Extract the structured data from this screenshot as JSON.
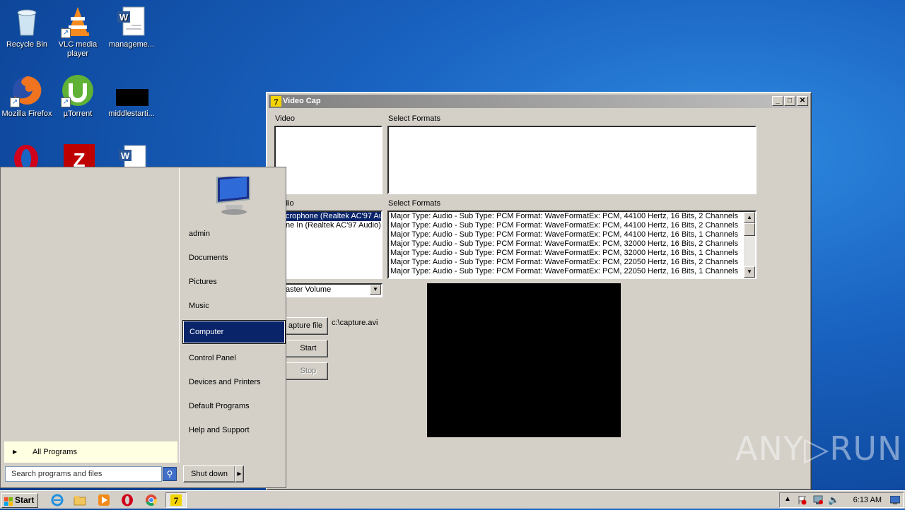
{
  "desktop": {
    "icons": [
      {
        "label": "Recycle Bin",
        "icon": "recycle-bin-icon"
      },
      {
        "label": "VLC media player",
        "icon": "vlc-icon"
      },
      {
        "label": "manageme...",
        "icon": "word-document-icon"
      },
      {
        "label": "Mozilla Firefox",
        "icon": "firefox-icon"
      },
      {
        "label": "µTorrent",
        "icon": "utorrent-icon"
      },
      {
        "label": "middlestarti...",
        "icon": "black-thumbnail-icon"
      }
    ]
  },
  "window": {
    "title": "Video Cap",
    "minimize": "_",
    "maximize": "□",
    "close": "✕",
    "video_label": "Video",
    "video_formats_label": "Select Formats",
    "audio_label": "dio",
    "audio_formats_label": "Select Formats",
    "audio_devices": [
      {
        "label": "crophone (Realtek AC'97 Au",
        "selected": true
      },
      {
        "label": "ne In (Realtek AC'97 Audio)",
        "selected": false
      }
    ],
    "audio_formats": [
      "Major Type: Audio - Sub Type: PCM Format: WaveFormatEx: PCM, 44100 Hertz, 16 Bits, 2 Channels",
      "Major Type: Audio - Sub Type: PCM Format: WaveFormatEx: PCM, 44100 Hertz, 16 Bits, 2 Channels",
      "Major Type: Audio - Sub Type: PCM Format: WaveFormatEx: PCM, 44100 Hertz, 16 Bits, 1 Channels",
      "Major Type: Audio - Sub Type: PCM Format: WaveFormatEx: PCM, 32000 Hertz, 16 Bits, 2 Channels",
      "Major Type: Audio - Sub Type: PCM Format: WaveFormatEx: PCM, 32000 Hertz, 16 Bits, 1 Channels",
      "Major Type: Audio - Sub Type: PCM Format: WaveFormatEx: PCM, 22050 Hertz, 16 Bits, 2 Channels",
      "Major Type: Audio - Sub Type: PCM Format: WaveFormatEx: PCM, 22050 Hertz, 16 Bits, 1 Channels"
    ],
    "volume_select": "aster Volume",
    "capture_file_button": "apture file",
    "capture_path": "c:\\capture.avi",
    "start_button": "Start",
    "stop_button": "Stop"
  },
  "start_menu": {
    "user": "admin",
    "right_items": [
      {
        "label": "Documents",
        "active": false
      },
      {
        "label": "Pictures",
        "active": false
      },
      {
        "label": "Music",
        "active": false
      },
      {
        "label": "Computer",
        "active": true
      },
      {
        "label": "Control Panel",
        "active": false
      },
      {
        "label": "Devices and Printers",
        "active": false
      },
      {
        "label": "Default Programs",
        "active": false
      },
      {
        "label": "Help and Support",
        "active": false
      }
    ],
    "all_programs": "All Programs",
    "search_placeholder": "Search programs and files",
    "shutdown": "Shut down"
  },
  "taskbar": {
    "start_label": "Start",
    "clock": "6:13 AM"
  },
  "watermark": "ANY▷RUN"
}
